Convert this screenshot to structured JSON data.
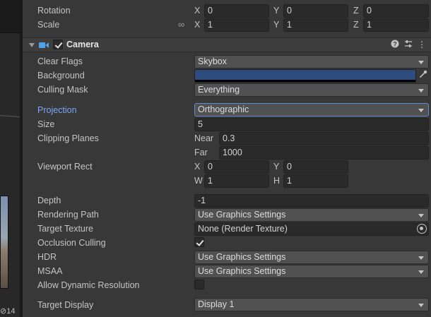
{
  "transform": {
    "rotation_label": "Rotation",
    "scale_label": "Scale",
    "rotation": {
      "x_axis": "X",
      "y_axis": "Y",
      "z_axis": "Z",
      "x": "0",
      "y": "0",
      "z": "0"
    },
    "scale": {
      "x_axis": "X",
      "y_axis": "Y",
      "z_axis": "Z",
      "x": "1",
      "y": "1",
      "z": "1"
    }
  },
  "component": {
    "title": "Camera",
    "help_icon": "help-icon",
    "settings_icon": "sliders-icon",
    "menu_icon": "kebab-menu-icon"
  },
  "camera": {
    "clear_flags": {
      "label": "Clear Flags",
      "value": "Skybox"
    },
    "background": {
      "label": "Background",
      "color": "#2e4c7e"
    },
    "culling_mask": {
      "label": "Culling Mask",
      "value": "Everything"
    },
    "projection": {
      "label": "Projection",
      "value": "Orthographic"
    },
    "size": {
      "label": "Size",
      "value": "5"
    },
    "clipping_planes": {
      "label": "Clipping Planes",
      "near_label": "Near",
      "near": "0.3",
      "far_label": "Far",
      "far": "1000"
    },
    "viewport_rect": {
      "label": "Viewport Rect",
      "x_label": "X",
      "x": "0",
      "y_label": "Y",
      "y": "0",
      "w_label": "W",
      "w": "1",
      "h_label": "H",
      "h": "1"
    },
    "depth": {
      "label": "Depth",
      "value": "-1"
    },
    "rendering_path": {
      "label": "Rendering Path",
      "value": "Use Graphics Settings"
    },
    "target_texture": {
      "label": "Target Texture",
      "value": "None (Render Texture)"
    },
    "occlusion_culling": {
      "label": "Occlusion Culling",
      "checked": true
    },
    "hdr": {
      "label": "HDR",
      "value": "Use Graphics Settings"
    },
    "msaa": {
      "label": "MSAA",
      "value": "Use Graphics Settings"
    },
    "allow_dynamic_resolution": {
      "label": "Allow Dynamic Resolution",
      "checked": false
    },
    "target_display": {
      "label": "Target Display",
      "value": "Display 1"
    }
  },
  "scene": {
    "visibility_count": "14"
  },
  "colors": {
    "accent": "#7aa8f4",
    "focus_border": "#5c8dd6",
    "camera_icon": "#4fa3e8"
  }
}
